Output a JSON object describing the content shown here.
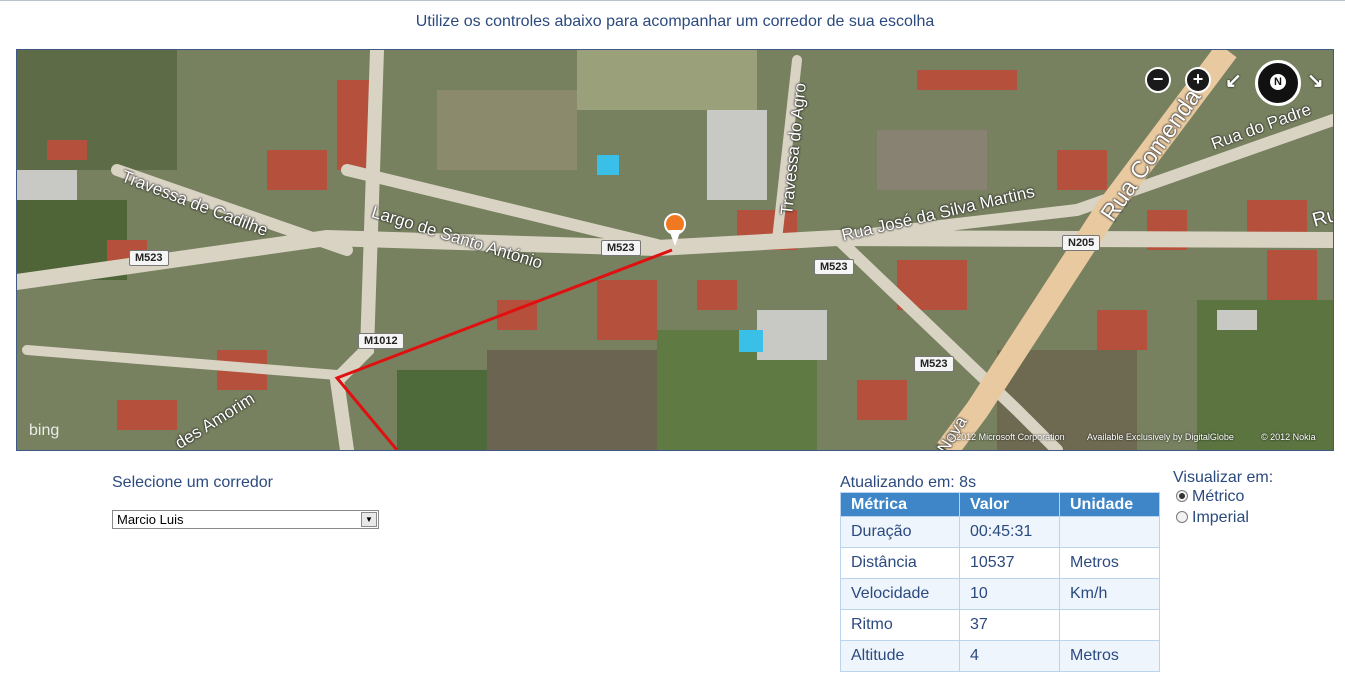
{
  "header": {
    "text": "Utilize os controles abaixo para acompanhar um corredor de sua escolha"
  },
  "map": {
    "streets": [
      "Travessa de Cadilhe",
      "Largo de Santo António",
      "Rua José da Silva Martins",
      "Travessa do Agro",
      "Rua Comenda",
      "Rua do Padre",
      "Ru",
      "des Amorim",
      "Nova"
    ],
    "shields": [
      "M523",
      "M523",
      "M523",
      "M523",
      "N205",
      "M1012"
    ],
    "controls": {
      "zoom_out": "−",
      "zoom_in": "+",
      "compass": "N",
      "rotate_left": "↙",
      "rotate_right": "↘"
    },
    "logo": "bing",
    "copyright": [
      "© 2012 Microsoft Corporation",
      "Available Exclusively by DigitalGlobe",
      "© 2012 Nokia"
    ],
    "colors": {
      "route": "#e01010",
      "pin": "#f07820"
    }
  },
  "runner": {
    "label": "Selecione um corredor",
    "selected": "Marcio Luis"
  },
  "metrics": {
    "updating": "Atualizando em: 8s",
    "headers": [
      "Métrica",
      "Valor",
      "Unidade"
    ],
    "rows": [
      {
        "metric": "Duração",
        "value": "00:45:31",
        "unit": ""
      },
      {
        "metric": "Distância",
        "value": "10537",
        "unit": "Metros"
      },
      {
        "metric": "Velocidade",
        "value": "10",
        "unit": "Km/h"
      },
      {
        "metric": "Ritmo",
        "value": "37",
        "unit": ""
      },
      {
        "metric": "Altitude",
        "value": "4",
        "unit": "Metros"
      }
    ]
  },
  "view": {
    "label": "Visualizar em:",
    "options": [
      "Métrico",
      "Imperial"
    ],
    "selected": "Métrico"
  }
}
